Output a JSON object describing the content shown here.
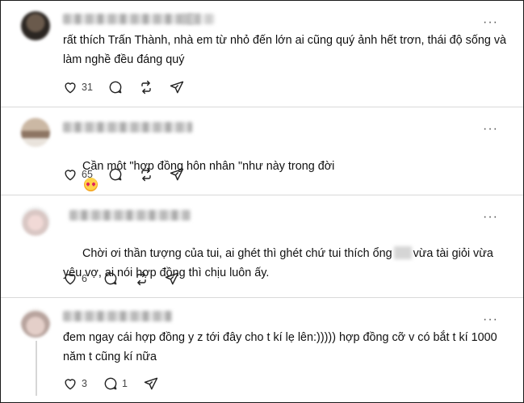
{
  "posts": [
    {
      "text": "rất thích Trấn Thành, nhà em từ nhỏ đến lớn ai cũng quý ảnh hết trơn, thái độ sống và làm nghề đều đáng quý",
      "likes": "31",
      "replies": "",
      "more_label": "···"
    },
    {
      "text_before": "Cần một \"hợp đồng hôn nhân \"như này trong đời",
      "emoji": "smiling-face-with-hearts",
      "likes": "65",
      "replies": "",
      "more_label": "···"
    },
    {
      "text_part1": "Chời ơi thần tượng của tui, ai ghét thì ghét chứ tui thích ổng",
      "text_part2": "vừa tài giỏi vừa yêu vợ, ai nói hợp đồng thì chịu luôn ấy.",
      "likes": "6",
      "replies": "",
      "more_label": "···"
    },
    {
      "text": "đem ngay cái hợp đồng y z tới đây cho t kí lẹ lên:))))) hợp đồng cỡ v có bắt t kí 1000 năm t cũng kí nữa",
      "likes": "3",
      "replies": "1",
      "more_label": "···"
    }
  ],
  "icons": {
    "like": "heart-icon",
    "reply": "comment-icon",
    "repost": "repost-icon",
    "share": "send-icon",
    "more": "more-icon"
  },
  "colors": {
    "text": "#101010",
    "divider": "#d9d9d9",
    "icon": "#222222",
    "count": "#444444"
  }
}
